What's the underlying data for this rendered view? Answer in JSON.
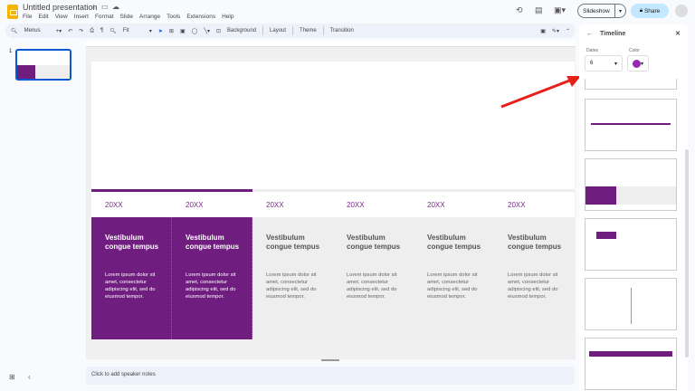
{
  "app": {
    "title": "Untitled presentation",
    "menus": [
      "File",
      "Edit",
      "View",
      "Insert",
      "Format",
      "Slide",
      "Arrange",
      "Tools",
      "Extensions",
      "Help"
    ]
  },
  "toolbar": {
    "search": "Menus",
    "zoom": "Fit",
    "items": [
      "Background",
      "Layout",
      "Theme",
      "Transition"
    ]
  },
  "header": {
    "slideshow": "Slideshow",
    "share": "Share"
  },
  "filmstrip": {
    "slide_number": "1"
  },
  "slide": {
    "accent": "#6f1d7f",
    "columns": [
      {
        "year": "20XX",
        "heading": "Vestibulum congue tempus",
        "body": "Lorem ipsum dolor sit amet, consectetur adipiscing elit, sed do eiusmod tempor.",
        "active": true
      },
      {
        "year": "20XX",
        "heading": "Vestibulum congue tempus",
        "body": "Lorem ipsum dolor sit amet, consectetur adipiscing elit, sed do eiusmod tempor.",
        "active": true
      },
      {
        "year": "20XX",
        "heading": "Vestibulum congue tempus",
        "body": "Lorem ipsum dolor sit amet, consectetur adipiscing elit, sed do eiusmod tempor.",
        "active": false
      },
      {
        "year": "20XX",
        "heading": "Vestibulum congue tempus",
        "body": "Lorem ipsum dolor sit amet, consectetur adipiscing elit, sed do eiusmod tempor.",
        "active": false
      },
      {
        "year": "20XX",
        "heading": "Vestibulum congue tempus",
        "body": "Lorem ipsum dolor sit amet, consectetur adipiscing elit, sed do eiusmod tempor.",
        "active": false
      },
      {
        "year": "20XX",
        "heading": "Vestibulum congue tempus",
        "body": "Lorem ipsum dolor sit amet, consectetur adipiscing elit, sed do eiusmod tempor.",
        "active": false
      }
    ]
  },
  "notes": {
    "placeholder": "Click to add speaker notes"
  },
  "panel": {
    "title": "Timeline",
    "dates_label": "Dates",
    "dates_value": "6",
    "color_label": "Color",
    "color_value": "#9c27b0"
  }
}
